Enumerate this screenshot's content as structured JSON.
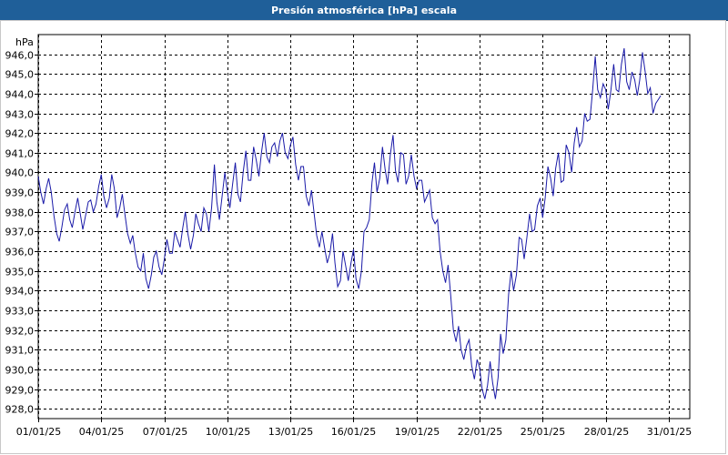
{
  "window": {
    "title": "Presión atmosférica [hPa] escala"
  },
  "chart_data": {
    "type": "line",
    "title": "Presión atmosférica [hPa] escala",
    "ylabel": "hPa",
    "xlabel": "",
    "ylim": [
      927.5,
      947.0
    ],
    "grid": true,
    "y_ticks": [
      928,
      929,
      930,
      931,
      932,
      933,
      934,
      935,
      936,
      937,
      938,
      939,
      940,
      941,
      942,
      943,
      944,
      945,
      946
    ],
    "y_tick_labels": [
      "928,0",
      "929,0",
      "930,0",
      "931,0",
      "932,0",
      "933,0",
      "934,0",
      "935,0",
      "936,0",
      "937,0",
      "938,0",
      "939,0",
      "940,0",
      "941,0",
      "942,0",
      "943,0",
      "944,0",
      "945,0",
      "946,0"
    ],
    "x_ticks": [
      0,
      3,
      6,
      9,
      12,
      15,
      18,
      21,
      24,
      27,
      30
    ],
    "x_tick_labels": [
      "01/01/25",
      "04/01/25",
      "07/01/25",
      "10/01/25",
      "13/01/25",
      "16/01/25",
      "19/01/25",
      "22/01/25",
      "25/01/25",
      "28/01/25",
      "31/01/25"
    ],
    "xlim": [
      0,
      31.0
    ],
    "series": [
      {
        "color": "#1a1aa8",
        "points": [
          [
            0.0,
            939.8
          ],
          [
            0.12,
            939.0
          ],
          [
            0.25,
            938.4
          ],
          [
            0.38,
            939.2
          ],
          [
            0.5,
            939.7
          ],
          [
            0.62,
            939.0
          ],
          [
            0.75,
            937.8
          ],
          [
            0.88,
            936.9
          ],
          [
            1.0,
            936.5
          ],
          [
            1.12,
            937.2
          ],
          [
            1.25,
            938.1
          ],
          [
            1.38,
            938.4
          ],
          [
            1.5,
            937.6
          ],
          [
            1.62,
            937.2
          ],
          [
            1.75,
            938.0
          ],
          [
            1.88,
            938.7
          ],
          [
            2.0,
            937.9
          ],
          [
            2.12,
            937.1
          ],
          [
            2.25,
            937.8
          ],
          [
            2.38,
            938.5
          ],
          [
            2.5,
            938.6
          ],
          [
            2.62,
            938.0
          ],
          [
            2.75,
            938.4
          ],
          [
            2.88,
            939.3
          ],
          [
            3.0,
            939.9
          ],
          [
            3.12,
            938.8
          ],
          [
            3.25,
            938.2
          ],
          [
            3.38,
            938.7
          ],
          [
            3.5,
            939.9
          ],
          [
            3.62,
            939.2
          ],
          [
            3.75,
            937.7
          ],
          [
            3.88,
            938.2
          ],
          [
            4.0,
            938.9
          ],
          [
            4.12,
            937.9
          ],
          [
            4.25,
            936.9
          ],
          [
            4.38,
            936.4
          ],
          [
            4.5,
            936.8
          ],
          [
            4.62,
            935.9
          ],
          [
            4.75,
            935.2
          ],
          [
            4.88,
            935.0
          ],
          [
            5.0,
            935.9
          ],
          [
            5.12,
            934.6
          ],
          [
            5.25,
            934.1
          ],
          [
            5.38,
            934.8
          ],
          [
            5.5,
            935.7
          ],
          [
            5.62,
            936.0
          ],
          [
            5.75,
            935.2
          ],
          [
            5.88,
            934.8
          ],
          [
            6.0,
            935.6
          ],
          [
            6.12,
            936.6
          ],
          [
            6.25,
            935.9
          ],
          [
            6.38,
            935.9
          ],
          [
            6.5,
            937.0
          ],
          [
            6.62,
            936.6
          ],
          [
            6.75,
            936.2
          ],
          [
            6.88,
            937.2
          ],
          [
            7.0,
            938.0
          ],
          [
            7.12,
            936.9
          ],
          [
            7.25,
            936.1
          ],
          [
            7.38,
            936.8
          ],
          [
            7.5,
            937.9
          ],
          [
            7.62,
            937.4
          ],
          [
            7.75,
            937.0
          ],
          [
            7.88,
            938.2
          ],
          [
            8.0,
            937.9
          ],
          [
            8.12,
            937.0
          ],
          [
            8.25,
            938.2
          ],
          [
            8.38,
            940.4
          ],
          [
            8.5,
            938.5
          ],
          [
            8.62,
            937.6
          ],
          [
            8.75,
            938.8
          ],
          [
            8.88,
            940.0
          ],
          [
            9.0,
            939.0
          ],
          [
            9.12,
            938.2
          ],
          [
            9.25,
            939.4
          ],
          [
            9.38,
            940.5
          ],
          [
            9.5,
            938.9
          ],
          [
            9.62,
            938.5
          ],
          [
            9.75,
            940.0
          ],
          [
            9.88,
            941.1
          ],
          [
            10.0,
            939.6
          ],
          [
            10.12,
            939.6
          ],
          [
            10.25,
            941.3
          ],
          [
            10.38,
            940.6
          ],
          [
            10.5,
            939.8
          ],
          [
            10.62,
            941.0
          ],
          [
            10.75,
            942.0
          ],
          [
            10.88,
            940.8
          ],
          [
            11.0,
            940.5
          ],
          [
            11.12,
            941.3
          ],
          [
            11.25,
            941.5
          ],
          [
            11.38,
            940.8
          ],
          [
            11.5,
            941.6
          ],
          [
            11.62,
            942.0
          ],
          [
            11.75,
            941.0
          ],
          [
            11.88,
            940.7
          ],
          [
            12.0,
            941.4
          ],
          [
            12.12,
            941.8
          ],
          [
            12.25,
            940.4
          ],
          [
            12.38,
            939.6
          ],
          [
            12.5,
            940.3
          ],
          [
            12.62,
            940.3
          ],
          [
            12.75,
            938.8
          ],
          [
            12.88,
            938.3
          ],
          [
            13.0,
            939.1
          ],
          [
            13.12,
            938.0
          ],
          [
            13.25,
            936.8
          ],
          [
            13.38,
            936.2
          ],
          [
            13.5,
            937.0
          ],
          [
            13.62,
            936.2
          ],
          [
            13.75,
            935.4
          ],
          [
            13.88,
            935.9
          ],
          [
            14.0,
            936.9
          ],
          [
            14.12,
            935.4
          ],
          [
            14.25,
            934.2
          ],
          [
            14.38,
            934.5
          ],
          [
            14.5,
            936.0
          ],
          [
            14.62,
            935.3
          ],
          [
            14.75,
            934.5
          ],
          [
            14.88,
            935.4
          ],
          [
            15.0,
            936.1
          ],
          [
            15.12,
            934.6
          ],
          [
            15.25,
            934.1
          ],
          [
            15.38,
            935.0
          ],
          [
            15.5,
            937.0
          ],
          [
            15.62,
            937.2
          ],
          [
            15.75,
            937.6
          ],
          [
            15.88,
            939.5
          ],
          [
            16.0,
            940.5
          ],
          [
            16.12,
            939.0
          ],
          [
            16.25,
            939.7
          ],
          [
            16.38,
            941.3
          ],
          [
            16.5,
            940.2
          ],
          [
            16.62,
            939.4
          ],
          [
            16.75,
            940.9
          ],
          [
            16.88,
            941.9
          ],
          [
            17.0,
            940.1
          ],
          [
            17.12,
            939.5
          ],
          [
            17.25,
            941.0
          ],
          [
            17.38,
            940.9
          ],
          [
            17.5,
            939.4
          ],
          [
            17.62,
            939.8
          ],
          [
            17.75,
            940.9
          ],
          [
            17.88,
            939.8
          ],
          [
            18.0,
            939.2
          ],
          [
            18.12,
            939.6
          ],
          [
            18.25,
            939.6
          ],
          [
            18.38,
            938.5
          ],
          [
            18.5,
            938.8
          ],
          [
            18.62,
            939.1
          ],
          [
            18.75,
            937.7
          ],
          [
            18.88,
            937.4
          ],
          [
            19.0,
            937.6
          ],
          [
            19.12,
            936.0
          ],
          [
            19.25,
            935.0
          ],
          [
            19.38,
            934.4
          ],
          [
            19.5,
            935.3
          ],
          [
            19.62,
            933.8
          ],
          [
            19.75,
            932.0
          ],
          [
            19.88,
            931.4
          ],
          [
            20.0,
            932.2
          ],
          [
            20.12,
            931.0
          ],
          [
            20.25,
            930.5
          ],
          [
            20.38,
            931.2
          ],
          [
            20.5,
            931.5
          ],
          [
            20.62,
            930.2
          ],
          [
            20.75,
            929.5
          ],
          [
            20.88,
            930.5
          ],
          [
            21.0,
            930.1
          ],
          [
            21.12,
            929.0
          ],
          [
            21.25,
            928.5
          ],
          [
            21.38,
            929.2
          ],
          [
            21.5,
            930.4
          ],
          [
            21.62,
            929.3
          ],
          [
            21.75,
            928.5
          ],
          [
            21.88,
            929.6
          ],
          [
            22.0,
            931.8
          ],
          [
            22.12,
            930.8
          ],
          [
            22.25,
            931.5
          ],
          [
            22.38,
            933.8
          ],
          [
            22.5,
            935.0
          ],
          [
            22.62,
            934.0
          ],
          [
            22.75,
            934.8
          ],
          [
            22.88,
            936.7
          ],
          [
            23.0,
            936.6
          ],
          [
            23.12,
            935.6
          ],
          [
            23.25,
            936.7
          ],
          [
            23.38,
            937.9
          ],
          [
            23.5,
            937.0
          ],
          [
            23.62,
            937.1
          ],
          [
            23.75,
            938.3
          ],
          [
            23.88,
            938.7
          ],
          [
            24.0,
            937.7
          ],
          [
            24.12,
            938.7
          ],
          [
            24.25,
            940.3
          ],
          [
            24.38,
            939.7
          ],
          [
            24.5,
            938.8
          ],
          [
            24.62,
            940.2
          ],
          [
            24.75,
            941.0
          ],
          [
            24.88,
            939.5
          ],
          [
            25.0,
            939.6
          ],
          [
            25.12,
            941.4
          ],
          [
            25.25,
            941.0
          ],
          [
            25.38,
            940.0
          ],
          [
            25.5,
            941.5
          ],
          [
            25.62,
            942.3
          ],
          [
            25.75,
            941.3
          ],
          [
            25.88,
            941.6
          ],
          [
            26.0,
            943.0
          ],
          [
            26.12,
            942.6
          ],
          [
            26.25,
            942.7
          ],
          [
            26.38,
            944.2
          ],
          [
            26.5,
            945.9
          ],
          [
            26.62,
            944.2
          ],
          [
            26.75,
            943.8
          ],
          [
            26.88,
            944.5
          ],
          [
            27.0,
            944.2
          ],
          [
            27.12,
            943.2
          ],
          [
            27.25,
            944.2
          ],
          [
            27.38,
            945.5
          ],
          [
            27.5,
            944.2
          ],
          [
            27.62,
            944.1
          ],
          [
            27.75,
            945.5
          ],
          [
            27.88,
            946.3
          ],
          [
            28.0,
            944.6
          ],
          [
            28.12,
            944.2
          ],
          [
            28.25,
            945.1
          ],
          [
            28.38,
            944.7
          ],
          [
            28.5,
            943.9
          ],
          [
            28.62,
            944.7
          ],
          [
            28.75,
            946.1
          ],
          [
            28.88,
            945.1
          ],
          [
            29.0,
            944.0
          ],
          [
            29.12,
            944.3
          ],
          [
            29.25,
            943.0
          ],
          [
            29.38,
            943.5
          ],
          [
            29.5,
            943.7
          ],
          [
            29.62,
            943.9
          ]
        ]
      }
    ]
  }
}
